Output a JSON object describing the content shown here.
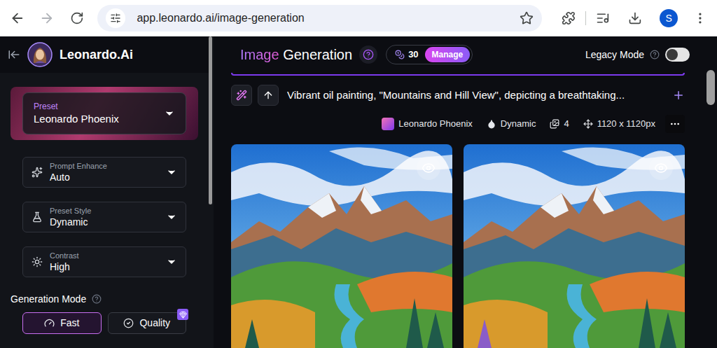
{
  "browser": {
    "address": "app.leonardo.ai/image-generation",
    "profile": "S"
  },
  "brand": "Leonardo.Ai",
  "sidebar": {
    "preset": {
      "label": "Preset",
      "value": "Leonardo Phoenix"
    },
    "dropdowns": [
      {
        "kind": "enhance",
        "label": "Prompt Enhance",
        "value": "Auto"
      },
      {
        "kind": "style",
        "label": "Preset Style",
        "value": "Dynamic"
      },
      {
        "kind": "contrast",
        "label": "Contrast",
        "value": "High"
      }
    ],
    "generation_mode": {
      "label": "Generation Mode",
      "options": [
        {
          "kind": "fast",
          "label": "Fast",
          "selected": true,
          "premium": false
        },
        {
          "kind": "quality",
          "label": "Quality",
          "selected": false,
          "premium": true
        }
      ]
    }
  },
  "header": {
    "title_accent": "Image",
    "title": "Generation",
    "credits": "30",
    "manage": "Manage",
    "legacy_mode": {
      "label": "Legacy Mode",
      "on": false
    }
  },
  "generation": {
    "prompt": "Vibrant oil painting, \"Mountains and Hill View\", depicting a breathtaking...",
    "meta": [
      {
        "kind": "model",
        "label": "Leonardo Phoenix"
      },
      {
        "kind": "style",
        "label": "Dynamic"
      },
      {
        "kind": "count",
        "label": "4"
      },
      {
        "kind": "size",
        "label": "1120 x 1120px"
      }
    ],
    "images": [
      {
        "preview": true
      },
      {
        "preview": true
      }
    ]
  }
}
